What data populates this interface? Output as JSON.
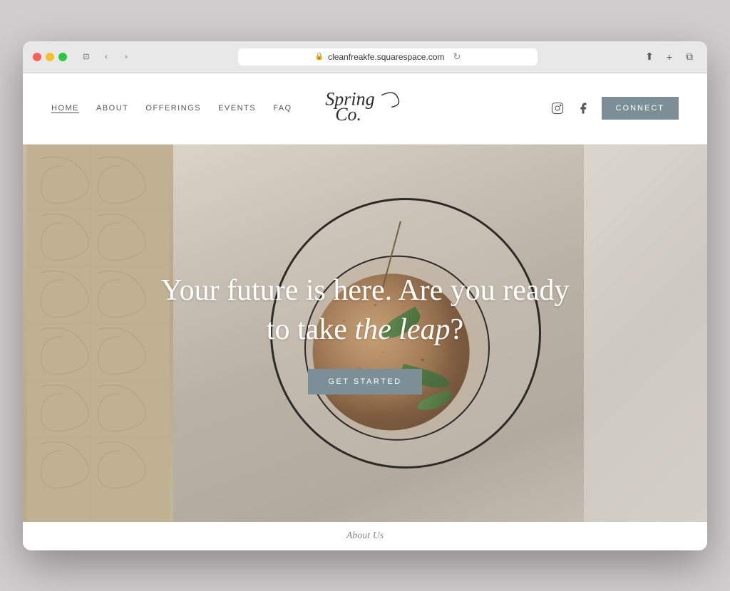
{
  "browser": {
    "address": "cleanfreakfe.squarespace.com",
    "traffic_lights": [
      "red",
      "yellow",
      "green"
    ]
  },
  "nav": {
    "links": [
      {
        "label": "HOME",
        "active": true
      },
      {
        "label": "ABOUT",
        "active": false
      },
      {
        "label": "OFFERINGS",
        "active": false
      },
      {
        "label": "EVENTS",
        "active": false
      },
      {
        "label": "FAQ",
        "active": false
      }
    ],
    "logo_alt": "Spring + Co",
    "connect_label": "CONNECT"
  },
  "hero": {
    "headline_line1": "Your future is here. Are you ready",
    "headline_line2": "to take ",
    "headline_italic": "the leap",
    "headline_end": "?",
    "cta_label": "GET STARTED"
  },
  "footer_teaser": {
    "label": "About Us"
  }
}
